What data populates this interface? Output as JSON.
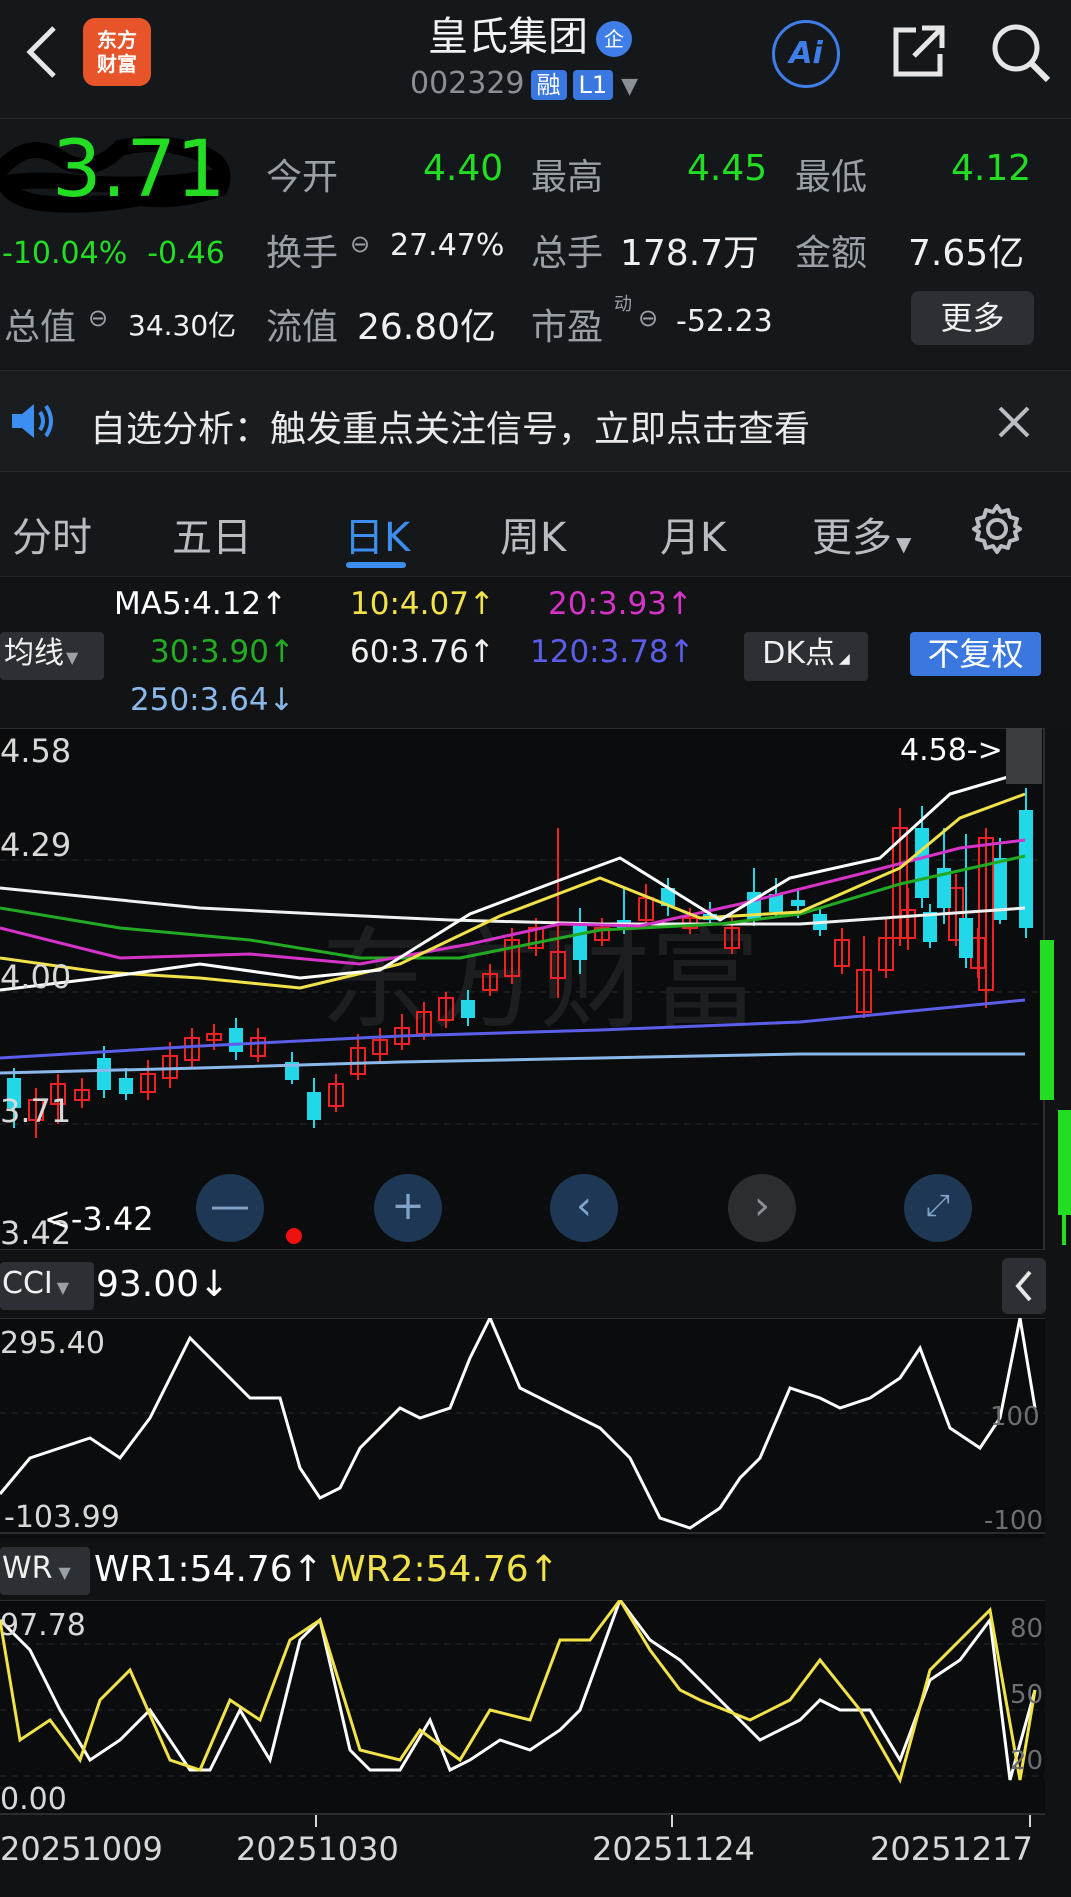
{
  "header": {
    "title": "皇氏集团",
    "title_badge": "企",
    "code": "002329",
    "tag_rong": "融",
    "tag_level": "L1",
    "logo_line1": "东方",
    "logo_line2": "财富",
    "ai_label": "Ai"
  },
  "quote": {
    "price": "3.71",
    "change_pct": "-10.04%",
    "change_abs": "-0.46",
    "open_label": "今开",
    "open": "4.40",
    "high_label": "最高",
    "high": "4.45",
    "low_label": "最低",
    "low": "4.12",
    "turnover_label": "换手",
    "turnover": "27.47%",
    "volume_label": "总手",
    "volume": "178.7万",
    "amount_label": "金额",
    "amount": "7.65亿",
    "mktcap_label": "总值",
    "mktcap": "34.30亿",
    "float_label": "流值",
    "float_cap": "26.80亿",
    "pe_label": "市盈",
    "pe_sup": "动",
    "pe": "-52.23",
    "more_button": "更多"
  },
  "notice": {
    "text": "自选分析：触发重点关注信号，立即点击查看"
  },
  "tabs": [
    {
      "label": "分时"
    },
    {
      "label": "五日"
    },
    {
      "label": "日K"
    },
    {
      "label": "周K"
    },
    {
      "label": "月K"
    },
    {
      "label": "更多"
    }
  ],
  "ma_legend": {
    "ma5": "MA5:4.12↑",
    "ma10": "10:4.07↑",
    "ma20": "20:3.93↑",
    "ma30": "30:3.90↑",
    "ma60": "60:3.76↑",
    "ma120": "120:3.78↑",
    "ma250": "250:3.64↓",
    "junxian": "均线",
    "dk": "DK点",
    "fuquan": "不复权"
  },
  "colors": {
    "up": "#ee2222",
    "down": "#22dd22",
    "candle_down": "#22d8e8",
    "ma5": "#ffffff",
    "ma10": "#f2e24a",
    "ma20": "#d633c9",
    "ma30": "#22aa22",
    "ma60": "#f0f0f0",
    "ma120": "#5a5ee8",
    "ma250": "#8ab8ea",
    "accent": "#3c8ef0"
  },
  "main_chart": {
    "y_labels": [
      "4.58",
      "4.29",
      "4.00",
      "3.71",
      "3.42"
    ],
    "max_marker": "4.58->",
    "min_marker": "<-3.42",
    "watermark": "东方财富"
  },
  "cci": {
    "name": "CCI",
    "value": "93.00↓",
    "top": "295.40",
    "bottom": "-103.99",
    "r100": "100",
    "rneg100": "-100"
  },
  "wr": {
    "name": "WR",
    "wr1": "WR1:54.76↑",
    "wr2": "WR2:54.76↑",
    "top": "97.78",
    "bottom": "0.00",
    "r80": "80",
    "r50": "50",
    "r20": "20"
  },
  "dates": [
    "20251009",
    "20251030",
    "20251124",
    "20251217"
  ],
  "icons": {
    "back": "back-icon",
    "share": "share-icon",
    "search": "search-icon",
    "speaker": "speaker-icon",
    "close": "close-icon",
    "gear": "gear-icon"
  }
}
